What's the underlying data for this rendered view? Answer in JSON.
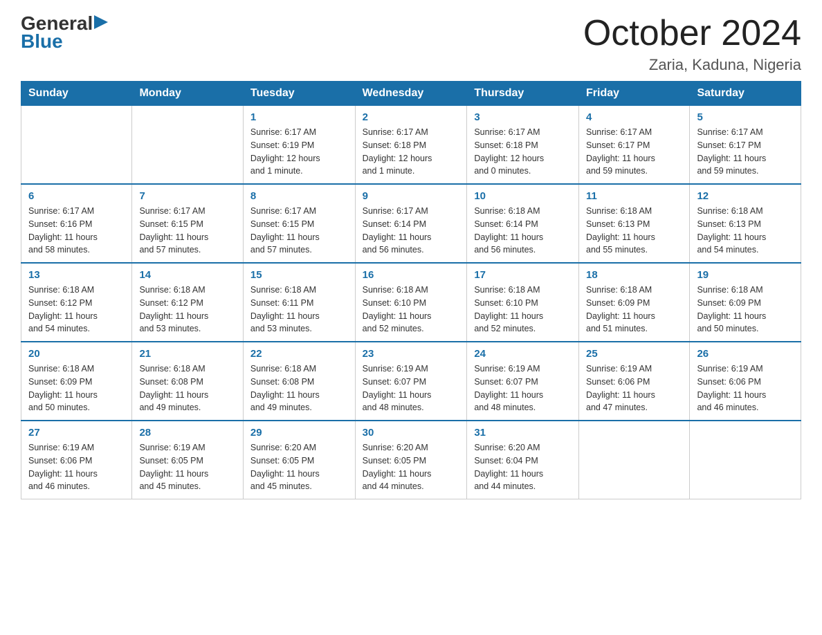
{
  "logo": {
    "line1_general": "General",
    "line1_triangle": "▶",
    "line2": "Blue"
  },
  "title": "October 2024",
  "location": "Zaria, Kaduna, Nigeria",
  "days_of_week": [
    "Sunday",
    "Monday",
    "Tuesday",
    "Wednesday",
    "Thursday",
    "Friday",
    "Saturday"
  ],
  "weeks": [
    [
      {
        "day": "",
        "info": ""
      },
      {
        "day": "",
        "info": ""
      },
      {
        "day": "1",
        "info": "Sunrise: 6:17 AM\nSunset: 6:19 PM\nDaylight: 12 hours\nand 1 minute."
      },
      {
        "day": "2",
        "info": "Sunrise: 6:17 AM\nSunset: 6:18 PM\nDaylight: 12 hours\nand 1 minute."
      },
      {
        "day": "3",
        "info": "Sunrise: 6:17 AM\nSunset: 6:18 PM\nDaylight: 12 hours\nand 0 minutes."
      },
      {
        "day": "4",
        "info": "Sunrise: 6:17 AM\nSunset: 6:17 PM\nDaylight: 11 hours\nand 59 minutes."
      },
      {
        "day": "5",
        "info": "Sunrise: 6:17 AM\nSunset: 6:17 PM\nDaylight: 11 hours\nand 59 minutes."
      }
    ],
    [
      {
        "day": "6",
        "info": "Sunrise: 6:17 AM\nSunset: 6:16 PM\nDaylight: 11 hours\nand 58 minutes."
      },
      {
        "day": "7",
        "info": "Sunrise: 6:17 AM\nSunset: 6:15 PM\nDaylight: 11 hours\nand 57 minutes."
      },
      {
        "day": "8",
        "info": "Sunrise: 6:17 AM\nSunset: 6:15 PM\nDaylight: 11 hours\nand 57 minutes."
      },
      {
        "day": "9",
        "info": "Sunrise: 6:17 AM\nSunset: 6:14 PM\nDaylight: 11 hours\nand 56 minutes."
      },
      {
        "day": "10",
        "info": "Sunrise: 6:18 AM\nSunset: 6:14 PM\nDaylight: 11 hours\nand 56 minutes."
      },
      {
        "day": "11",
        "info": "Sunrise: 6:18 AM\nSunset: 6:13 PM\nDaylight: 11 hours\nand 55 minutes."
      },
      {
        "day": "12",
        "info": "Sunrise: 6:18 AM\nSunset: 6:13 PM\nDaylight: 11 hours\nand 54 minutes."
      }
    ],
    [
      {
        "day": "13",
        "info": "Sunrise: 6:18 AM\nSunset: 6:12 PM\nDaylight: 11 hours\nand 54 minutes."
      },
      {
        "day": "14",
        "info": "Sunrise: 6:18 AM\nSunset: 6:12 PM\nDaylight: 11 hours\nand 53 minutes."
      },
      {
        "day": "15",
        "info": "Sunrise: 6:18 AM\nSunset: 6:11 PM\nDaylight: 11 hours\nand 53 minutes."
      },
      {
        "day": "16",
        "info": "Sunrise: 6:18 AM\nSunset: 6:10 PM\nDaylight: 11 hours\nand 52 minutes."
      },
      {
        "day": "17",
        "info": "Sunrise: 6:18 AM\nSunset: 6:10 PM\nDaylight: 11 hours\nand 52 minutes."
      },
      {
        "day": "18",
        "info": "Sunrise: 6:18 AM\nSunset: 6:09 PM\nDaylight: 11 hours\nand 51 minutes."
      },
      {
        "day": "19",
        "info": "Sunrise: 6:18 AM\nSunset: 6:09 PM\nDaylight: 11 hours\nand 50 minutes."
      }
    ],
    [
      {
        "day": "20",
        "info": "Sunrise: 6:18 AM\nSunset: 6:09 PM\nDaylight: 11 hours\nand 50 minutes."
      },
      {
        "day": "21",
        "info": "Sunrise: 6:18 AM\nSunset: 6:08 PM\nDaylight: 11 hours\nand 49 minutes."
      },
      {
        "day": "22",
        "info": "Sunrise: 6:18 AM\nSunset: 6:08 PM\nDaylight: 11 hours\nand 49 minutes."
      },
      {
        "day": "23",
        "info": "Sunrise: 6:19 AM\nSunset: 6:07 PM\nDaylight: 11 hours\nand 48 minutes."
      },
      {
        "day": "24",
        "info": "Sunrise: 6:19 AM\nSunset: 6:07 PM\nDaylight: 11 hours\nand 48 minutes."
      },
      {
        "day": "25",
        "info": "Sunrise: 6:19 AM\nSunset: 6:06 PM\nDaylight: 11 hours\nand 47 minutes."
      },
      {
        "day": "26",
        "info": "Sunrise: 6:19 AM\nSunset: 6:06 PM\nDaylight: 11 hours\nand 46 minutes."
      }
    ],
    [
      {
        "day": "27",
        "info": "Sunrise: 6:19 AM\nSunset: 6:06 PM\nDaylight: 11 hours\nand 46 minutes."
      },
      {
        "day": "28",
        "info": "Sunrise: 6:19 AM\nSunset: 6:05 PM\nDaylight: 11 hours\nand 45 minutes."
      },
      {
        "day": "29",
        "info": "Sunrise: 6:20 AM\nSunset: 6:05 PM\nDaylight: 11 hours\nand 45 minutes."
      },
      {
        "day": "30",
        "info": "Sunrise: 6:20 AM\nSunset: 6:05 PM\nDaylight: 11 hours\nand 44 minutes."
      },
      {
        "day": "31",
        "info": "Sunrise: 6:20 AM\nSunset: 6:04 PM\nDaylight: 11 hours\nand 44 minutes."
      },
      {
        "day": "",
        "info": ""
      },
      {
        "day": "",
        "info": ""
      }
    ]
  ]
}
